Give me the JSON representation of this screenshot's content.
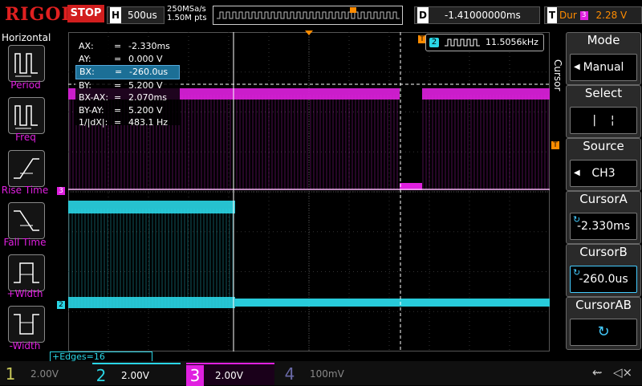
{
  "top": {
    "logo": "RIGOL",
    "run_status": "STOP",
    "horizontal_key": "H",
    "timebase": "500us",
    "sample_rate": "250MSa/s",
    "memory_depth": "1.50M pts",
    "delay_key": "D",
    "delay": "-1.41000000ms",
    "trigger_key": "T",
    "trigger_type": "Dur",
    "trigger_source": "3",
    "trigger_level": "2.28 V"
  },
  "left_menu": {
    "title": "Horizontal",
    "items": [
      {
        "label": "Period"
      },
      {
        "label": "Freq"
      },
      {
        "label": "Rise Time"
      },
      {
        "label": "Fall Time"
      },
      {
        "label": "+Width"
      },
      {
        "label": "-Width"
      }
    ]
  },
  "measurements": {
    "rows": [
      {
        "key": "AX:",
        "eq": "=",
        "val": "-2.330ms"
      },
      {
        "key": "AY:",
        "eq": "=",
        "val": "0.000 V"
      },
      {
        "key": "BX:",
        "eq": "=",
        "val": "-260.0us"
      },
      {
        "key": "BY:",
        "eq": "=",
        "val": "5.200 V"
      },
      {
        "key": "BX-AX:",
        "eq": "=",
        "val": "2.070ms"
      },
      {
        "key": "BY-AY:",
        "eq": "=",
        "val": "5.200 V"
      },
      {
        "key": "1/|dX|:",
        "eq": "=",
        "val": "483.1 Hz"
      }
    ]
  },
  "frequency_counter": {
    "channel": "2",
    "value": "11.5056kHz"
  },
  "markers": {
    "ch3": "3",
    "ch2": "2",
    "trigger": "T",
    "trigger_right": "T"
  },
  "bottom": {
    "edges": "+Edges=16",
    "channels": [
      {
        "num": "1",
        "scale": "2.00V",
        "color": "#c9c95a"
      },
      {
        "num": "2",
        "scale": "2.00V",
        "color": "#2ad6e6"
      },
      {
        "num": "3",
        "scale": "2.00V",
        "color": "#e020e0"
      },
      {
        "num": "4",
        "scale": "100mV",
        "color": "#6a6aa8"
      }
    ]
  },
  "right_menu": {
    "side_label": "Cursor",
    "mode_title": "Mode",
    "mode_value": "Manual",
    "select_title": "Select",
    "source_title": "Source",
    "source_value": "CH3",
    "cursor_a_title": "CursorA",
    "cursor_a_value": "-2.330ms",
    "cursor_b_title": "CursorB",
    "cursor_b_value": "-260.0us",
    "cursor_ab_title": "CursorAB"
  },
  "colors": {
    "ch1": "#c9c95a",
    "ch2": "#2ad6e6",
    "ch3": "#e020e0",
    "ch4": "#6a6aa8",
    "trigger": "#ff8c00",
    "stop": "#d21e1e"
  }
}
